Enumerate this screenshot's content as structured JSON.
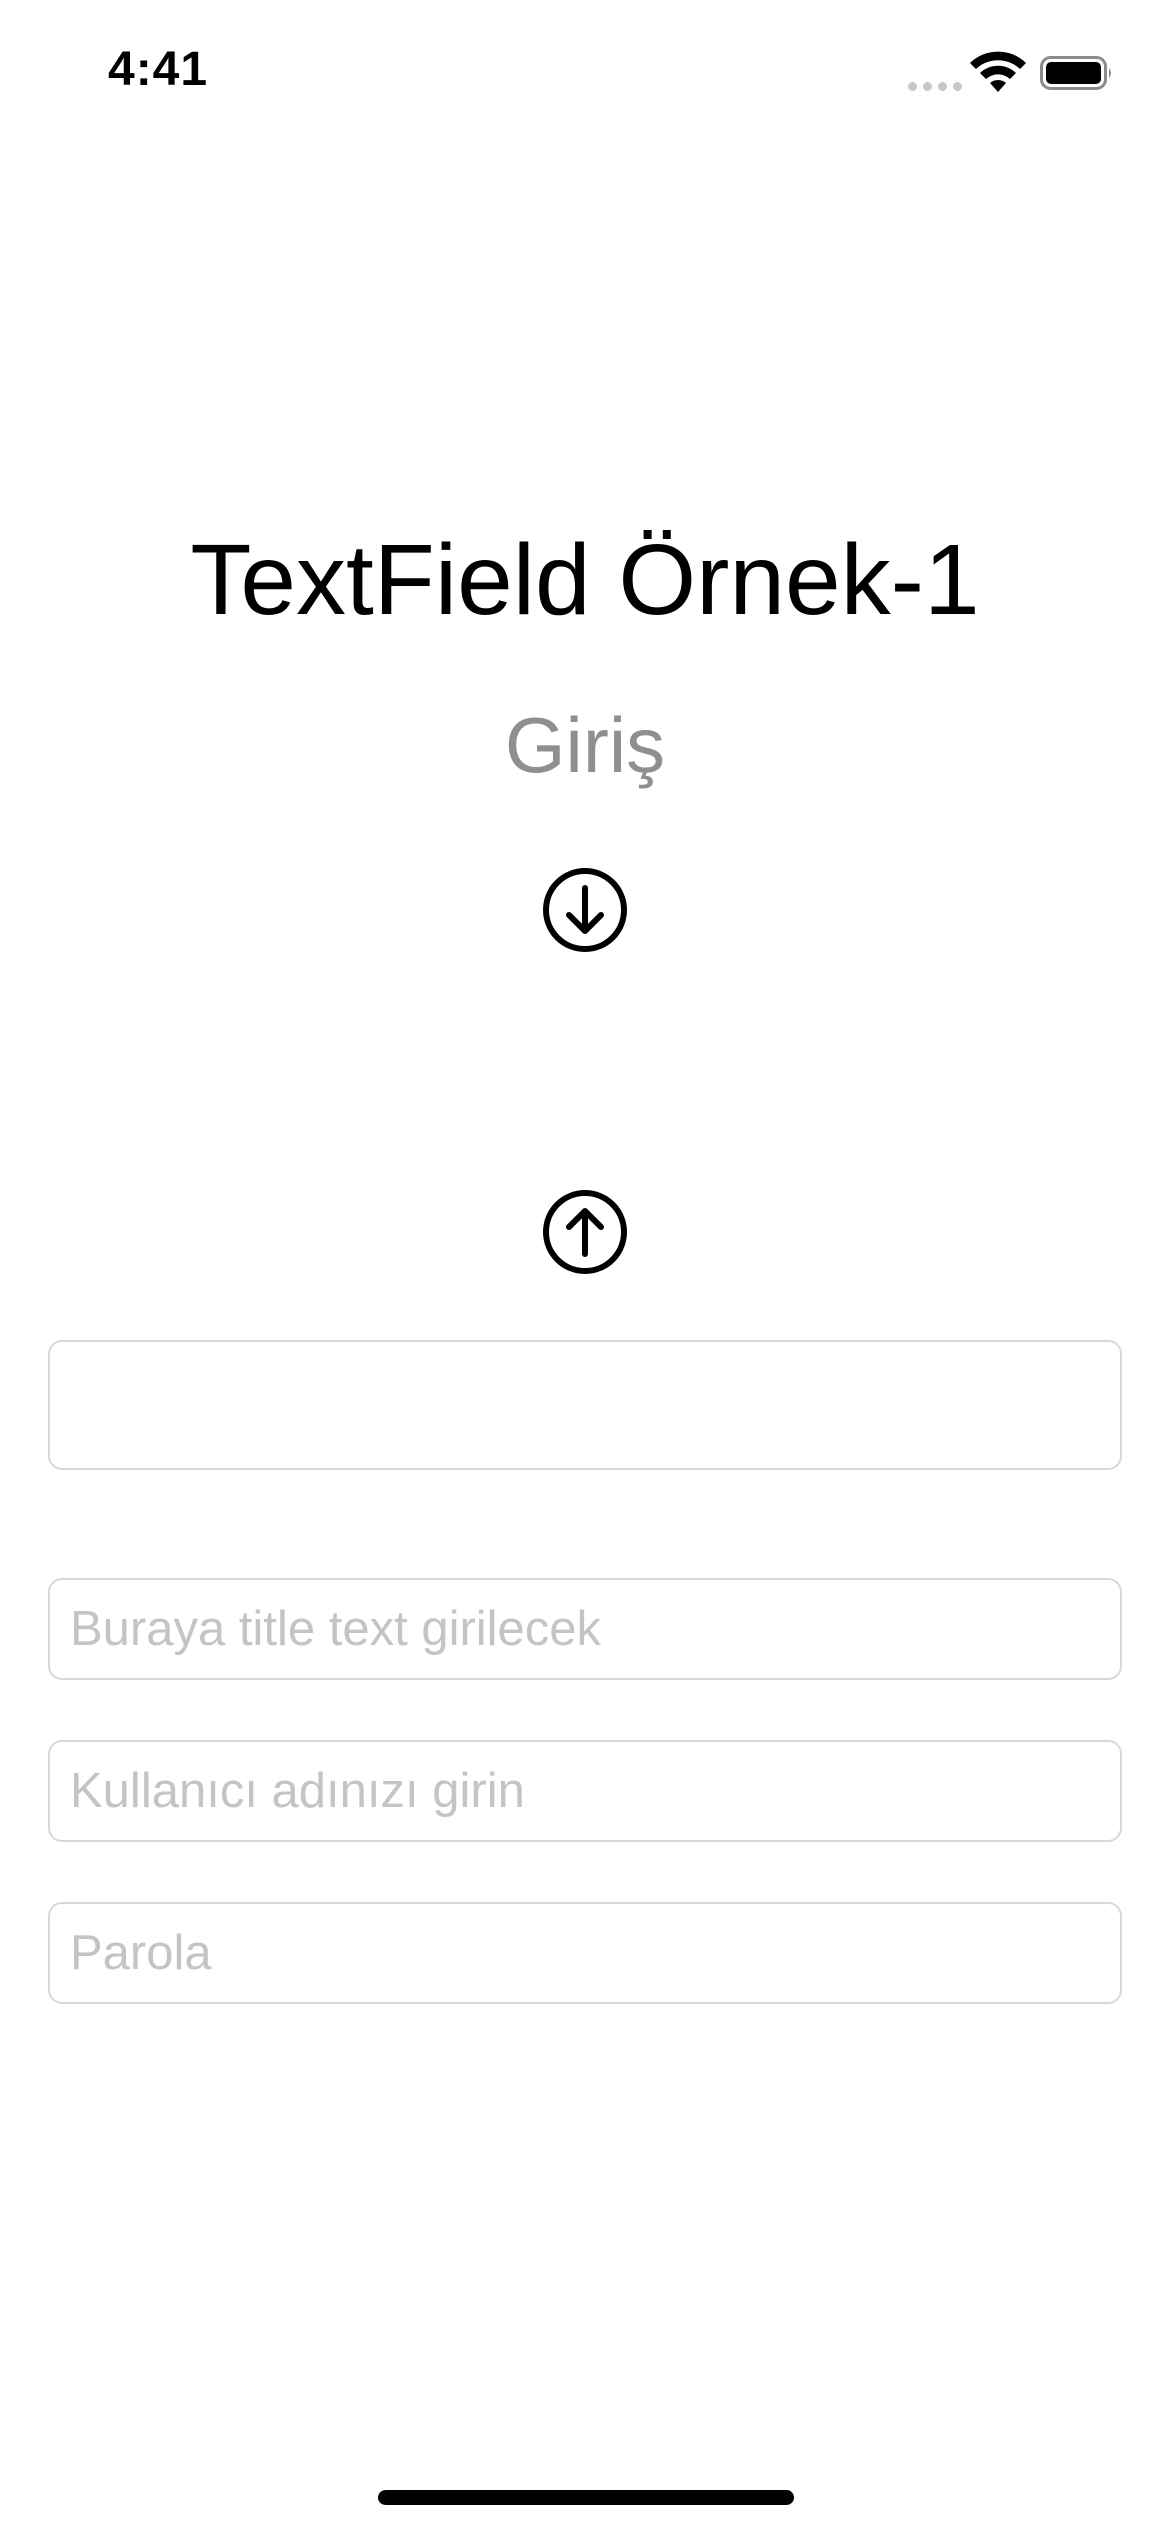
{
  "status_bar": {
    "time": "4:41"
  },
  "main": {
    "title": "TextField Örnek-1",
    "subtitle": "Giriş",
    "down_icon": "arrow-down-circle",
    "up_icon": "arrow-up-circle"
  },
  "fields": {
    "large_field": {
      "value": "",
      "placeholder": ""
    },
    "title_field": {
      "value": "",
      "placeholder": "Buraya title text girilecek"
    },
    "username_field": {
      "value": "",
      "placeholder": "Kullanıcı adınızı girin"
    },
    "password_field": {
      "value": "",
      "placeholder": "Parola"
    }
  }
}
